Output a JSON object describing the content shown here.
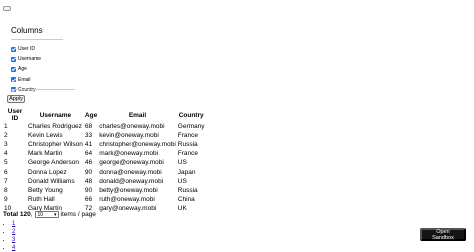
{
  "columns_panel": {
    "title": "Columns",
    "items": [
      {
        "label": "User ID",
        "checked": true
      },
      {
        "label": "Username",
        "checked": true
      },
      {
        "label": "Age",
        "checked": true
      },
      {
        "label": "Email",
        "checked": true
      },
      {
        "label": "Country",
        "checked": true
      }
    ],
    "apply_label": "Apply"
  },
  "table": {
    "headers": [
      "User ID",
      "Username",
      "Age",
      "Email",
      "Country"
    ],
    "rows": [
      [
        "1",
        "Charles Rodriguez",
        "68",
        "charles@oneway.mobi",
        "Germany"
      ],
      [
        "2",
        "Kevin Lewis",
        "33",
        "kevin@oneway.mobi",
        "France"
      ],
      [
        "3",
        "Christopher Wilson",
        "41",
        "christopher@oneway.mobi",
        "Russia"
      ],
      [
        "4",
        "Mark Martin",
        "64",
        "mark@oneway.mobi",
        "France"
      ],
      [
        "5",
        "George Anderson",
        "46",
        "george@oneway.mobi",
        "US"
      ],
      [
        "6",
        "Donna Lopez",
        "90",
        "donna@oneway.mobi",
        "Japan"
      ],
      [
        "7",
        "Donald Williams",
        "48",
        "donald@oneway.mobi",
        "US"
      ],
      [
        "8",
        "Betty Young",
        "90",
        "betty@oneway.mobi",
        "Russia"
      ],
      [
        "9",
        "Ruth Hall",
        "66",
        "ruth@oneway.mobi",
        "China"
      ],
      [
        "10",
        "Gary Martin",
        "72",
        "gary@oneway.mobi",
        "UK"
      ]
    ]
  },
  "pagination": {
    "total_label": "Total 120",
    "separator": ",",
    "page_size": "10",
    "items_per_page_label": "items / page",
    "pages": [
      "1",
      "2",
      "3",
      "4"
    ]
  },
  "sandbox_button": "Open Sandbox",
  "colors": {
    "checkbox": "#1a73e8",
    "sandbox_bg": "#151515"
  }
}
